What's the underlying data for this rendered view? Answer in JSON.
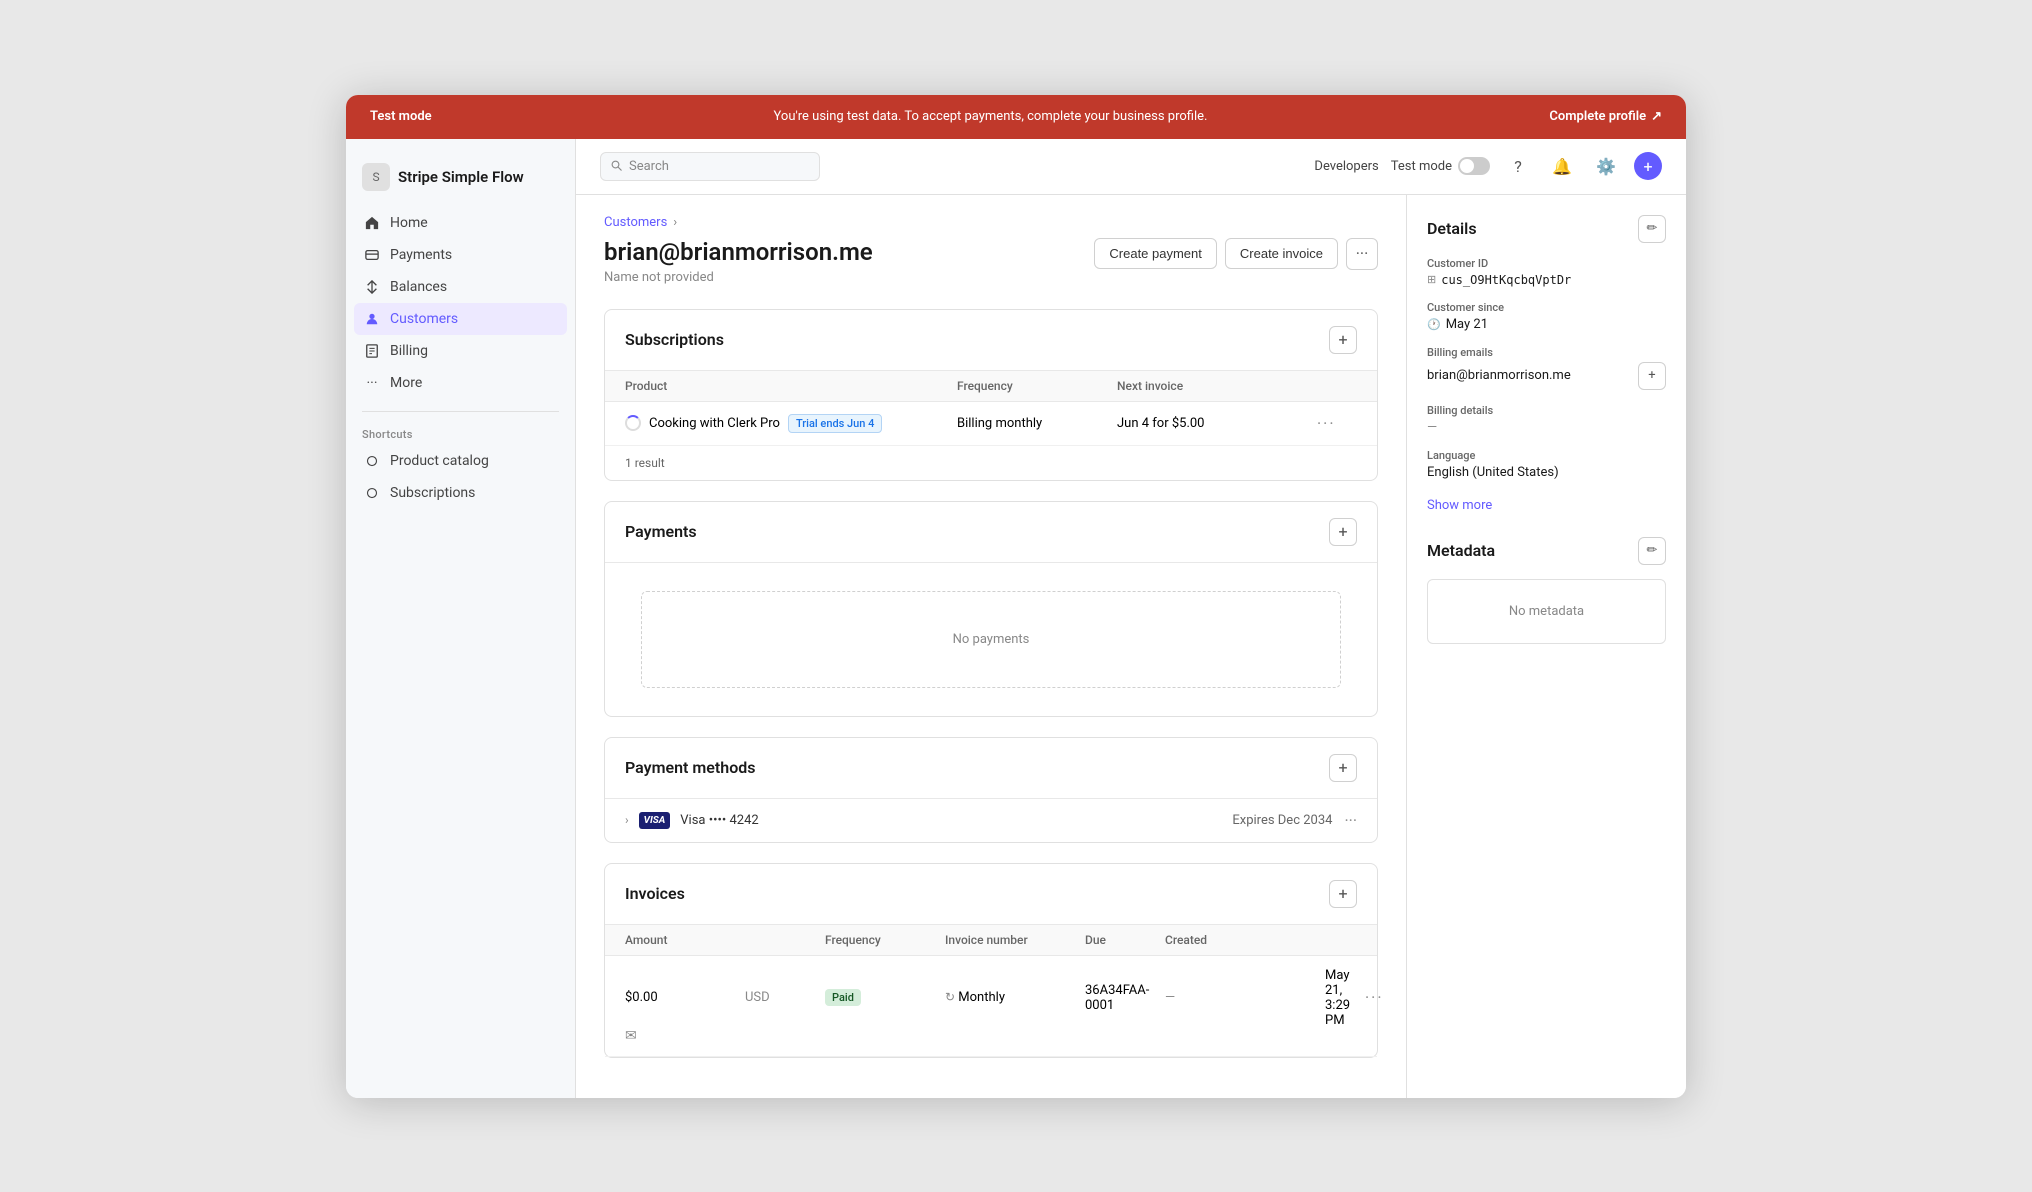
{
  "testBanner": {
    "left": "Test mode",
    "center": "You're using test data. To accept payments, complete your business profile.",
    "right": "Complete profile"
  },
  "sidebar": {
    "logoText": "Stripe Simple Flow",
    "navItems": [
      {
        "id": "home",
        "label": "Home",
        "icon": "🏠",
        "active": false
      },
      {
        "id": "payments",
        "label": "Payments",
        "icon": "💳",
        "active": false
      },
      {
        "id": "balances",
        "label": "Balances",
        "icon": "⚖️",
        "active": false
      },
      {
        "id": "customers",
        "label": "Customers",
        "icon": "👤",
        "active": true
      },
      {
        "id": "billing",
        "label": "Billing",
        "icon": "📄",
        "active": false
      },
      {
        "id": "more",
        "label": "More",
        "icon": "···",
        "active": false
      }
    ],
    "shortcutsTitle": "Shortcuts",
    "shortcuts": [
      {
        "id": "product-catalog",
        "label": "Product catalog",
        "icon": "🏷️"
      },
      {
        "id": "subscriptions",
        "label": "Subscriptions",
        "icon": "🔄"
      }
    ]
  },
  "topbar": {
    "searchPlaceholder": "Search",
    "developers": "Developers",
    "testMode": "Test mode"
  },
  "breadcrumb": {
    "parent": "Customers",
    "separator": "›"
  },
  "header": {
    "email": "brian@brianmorrison.me",
    "subtitle": "Name not provided",
    "createPaymentBtn": "Create payment",
    "createInvoiceBtn": "Create invoice"
  },
  "subscriptions": {
    "sectionTitle": "Subscriptions",
    "columns": [
      "Product",
      "Frequency",
      "Next invoice"
    ],
    "rows": [
      {
        "product": "Cooking with Clerk Pro",
        "badge": "Trial ends Jun 4",
        "frequency": "Billing monthly",
        "nextInvoice": "Jun 4 for $5.00"
      }
    ],
    "resultCount": "1 result"
  },
  "payments": {
    "sectionTitle": "Payments",
    "emptyText": "No payments"
  },
  "paymentMethods": {
    "sectionTitle": "Payment methods",
    "rows": [
      {
        "brand": "VISA",
        "last4": "4242",
        "displayName": "Visa •••• 4242",
        "expiry": "Expires Dec 2034"
      }
    ]
  },
  "invoices": {
    "sectionTitle": "Invoices",
    "columns": [
      "Amount",
      "",
      "Frequency",
      "Invoice number",
      "Due",
      "Created",
      "",
      ""
    ],
    "rows": [
      {
        "amount": "$0.00",
        "currency": "USD",
        "status": "Paid",
        "frequency": "Monthly",
        "invoiceNumber": "36A34FAA-0001",
        "due": "—",
        "created": "May 21, 3:29 PM"
      }
    ]
  },
  "details": {
    "sectionTitle": "Details",
    "customerId": {
      "label": "Customer ID",
      "value": "cus_O9HtKqcbqVptDr"
    },
    "customerSince": {
      "label": "Customer since",
      "value": "May 21"
    },
    "billingEmails": {
      "label": "Billing emails",
      "value": "brian@brianmorrison.me"
    },
    "billingDetails": {
      "label": "Billing details",
      "value": "—"
    },
    "language": {
      "label": "Language",
      "value": "English (United States)"
    },
    "showMore": "Show more"
  },
  "metadata": {
    "sectionTitle": "Metadata",
    "emptyText": "No metadata"
  }
}
